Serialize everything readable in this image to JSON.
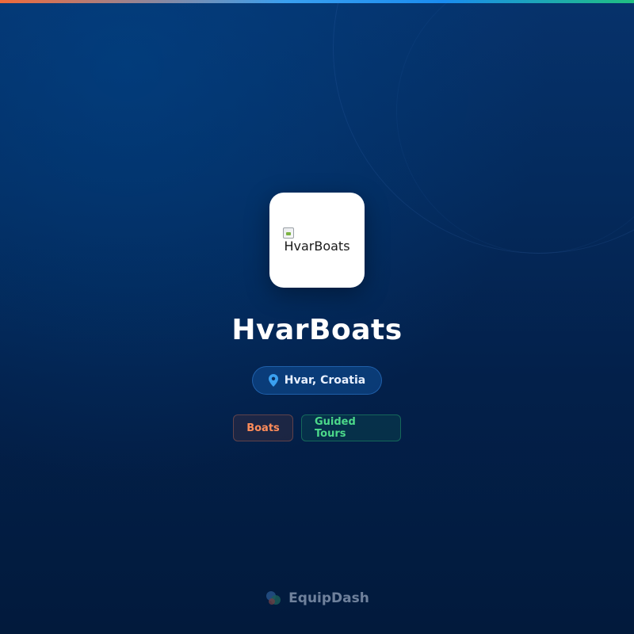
{
  "page": {
    "background_color": "#031a40",
    "accent_gradient": [
      "#f06a3a",
      "#3aa0f0",
      "#20c080"
    ]
  },
  "listing": {
    "logo_alt": "HvarBoats",
    "logo_icon": "broken-image-icon",
    "title": "HvarBoats",
    "location": {
      "icon": "map-pin-icon",
      "text": "Hvar, Croatia",
      "color": "#3aa0f0"
    },
    "tags": [
      {
        "label": "Boats",
        "color": "#ff8c5a"
      },
      {
        "label": "Guided Tours",
        "color": "#4cd98a"
      }
    ]
  },
  "footer": {
    "brand_icon": "equipdash-logo-icon",
    "brand_name": "EquipDash"
  }
}
